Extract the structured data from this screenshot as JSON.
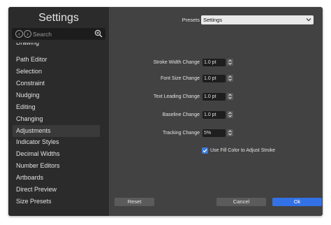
{
  "sidebar": {
    "title": "Settings",
    "search": {
      "placeholder": "Search",
      "value": ""
    },
    "items": [
      {
        "label": "Drawing"
      },
      {
        "label": "Path Editor"
      },
      {
        "label": "Selection"
      },
      {
        "label": "Constraint"
      },
      {
        "label": "Nudging"
      },
      {
        "label": "Editing"
      },
      {
        "label": "Changing"
      },
      {
        "label": "Adjustments",
        "selected": true
      },
      {
        "label": "Indicator Styles"
      },
      {
        "label": "Decimal Widths"
      },
      {
        "label": "Number Editors"
      },
      {
        "label": "Artboards"
      },
      {
        "label": "Direct Preview"
      },
      {
        "label": "Size Presets"
      }
    ]
  },
  "main": {
    "presets": {
      "label": "Presets",
      "value": "Settings"
    },
    "rows": [
      {
        "label": "Stroke Width Change",
        "value": "1.0 pt"
      },
      {
        "label": "Font Size Change",
        "value": "1.0 pt"
      },
      {
        "label": "Text Leading Change",
        "value": "1.0 pt"
      },
      {
        "label": "Baseline Change",
        "value": "1.0 pt"
      },
      {
        "label": "Tracking Change",
        "value": "5%"
      }
    ],
    "checkbox": {
      "label": "Use Fill Color to Adjust Stroke",
      "checked": true
    }
  },
  "footer": {
    "reset_label": "Reset",
    "cancel_label": "Cancel",
    "ok_label": "Ok"
  },
  "colors": {
    "accent": "#3272e6",
    "checkbox": "#3b7bd9",
    "sidebar_bg": "#2b2b2b",
    "window_bg": "#424242"
  },
  "icons": {
    "back": "chevron-left-icon",
    "forward": "chevron-right-icon",
    "search": "zoom-icon",
    "presets": "chevron-down-icon",
    "stepper": "stepper-icon",
    "check": "checkmark-icon"
  }
}
